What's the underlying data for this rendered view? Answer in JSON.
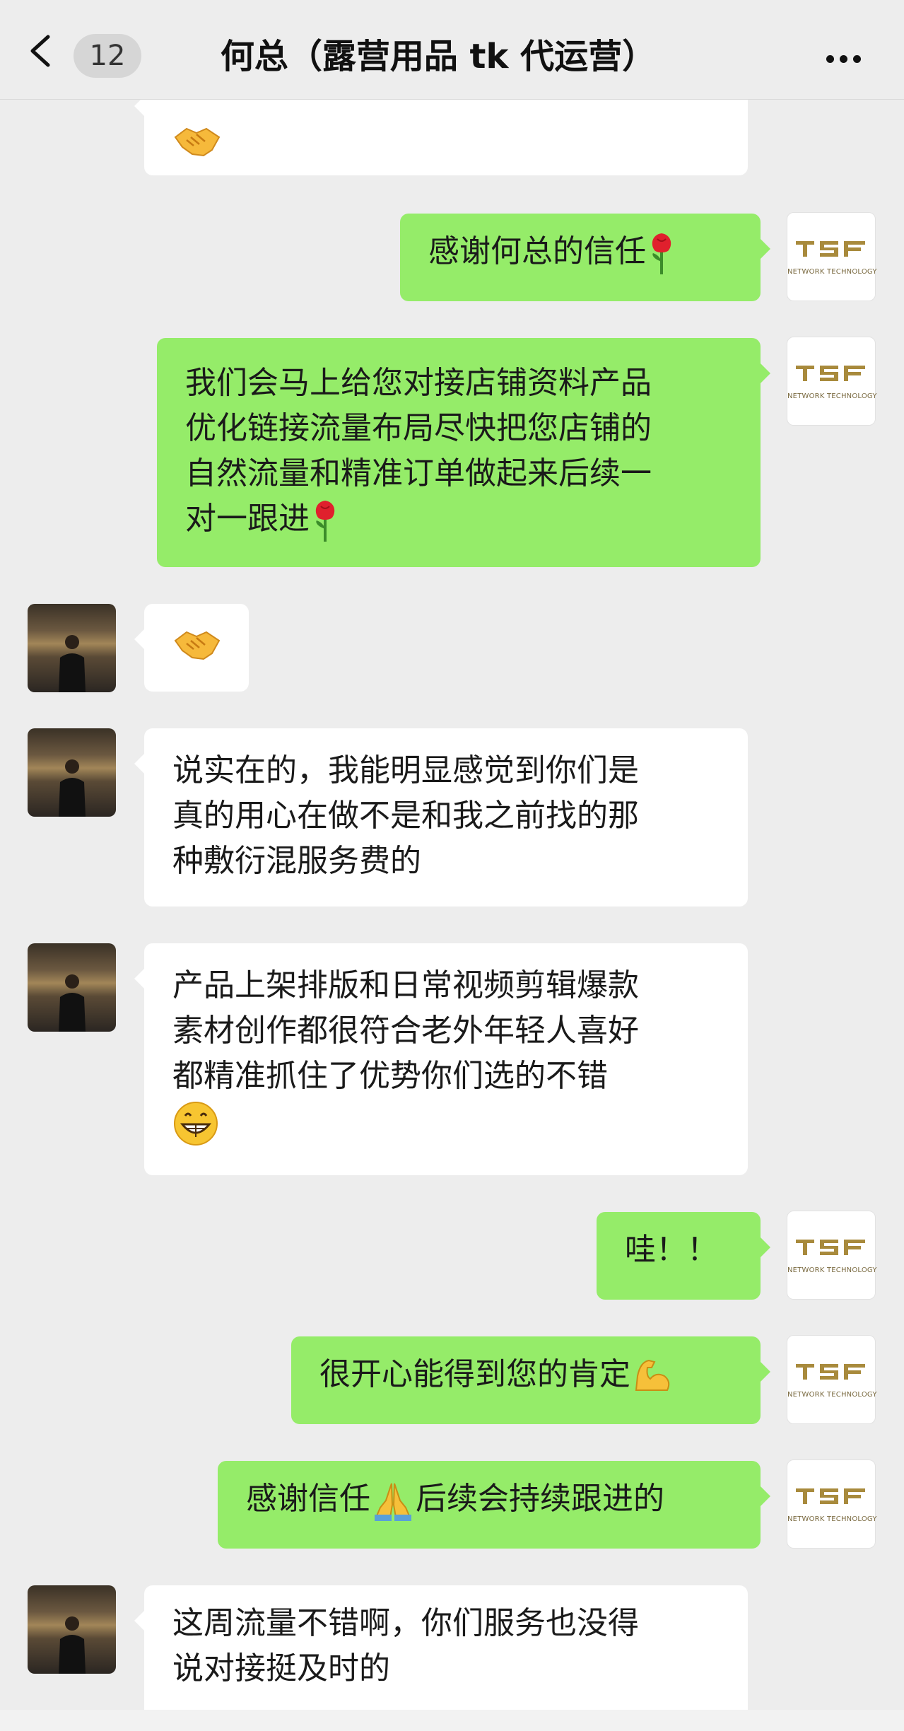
{
  "header": {
    "back_icon": "chevron-left-icon",
    "unread_count": "12",
    "title": "何总（露营用品 tk 代运营）",
    "more_icon": "ellipsis-icon"
  },
  "tsf_avatar": {
    "logo_text": "TSF",
    "subtitle": "NETWORK TECHNOLOGY"
  },
  "messages": [
    {
      "sender": "user",
      "text": "",
      "emoji": "handshake"
    },
    {
      "sender": "self",
      "text": "感谢何总的信任",
      "emoji": "rose"
    },
    {
      "sender": "self",
      "lines": [
        "我们会马上给您对接店铺资料产品",
        "优化链接流量布局尽快把您店铺的",
        "自然流量和精准订单做起来后续一",
        "对一跟进"
      ],
      "emoji": "rose"
    },
    {
      "sender": "user",
      "text": "",
      "emoji": "handshake"
    },
    {
      "sender": "user",
      "lines": [
        "说实在的，我能明显感觉到你们是",
        "真的用心在做不是和我之前找的那",
        "种敷衍混服务费的"
      ]
    },
    {
      "sender": "user",
      "lines": [
        "产品上架排版和日常视频剪辑爆款",
        "素材创作都很符合老外年轻人喜好",
        "都精准抓住了优势你们选的不错"
      ],
      "emoji": "grinning-face"
    },
    {
      "sender": "self",
      "text": "哇！！"
    },
    {
      "sender": "self",
      "text": "很开心能得到您的肯定",
      "emoji": "flexed-biceps"
    },
    {
      "sender": "self",
      "text_before": "感谢信任",
      "emoji": "folded-hands",
      "text_after": "后续会持续跟进的"
    },
    {
      "sender": "user",
      "lines": [
        "这周流量不错啊，你们服务也没得",
        "说对接挺及时的"
      ]
    }
  ],
  "colors": {
    "background": "#ededed",
    "incoming_bubble": "#ffffff",
    "outgoing_bubble": "#95ec69",
    "tsf_gold": "#a88a3c"
  }
}
